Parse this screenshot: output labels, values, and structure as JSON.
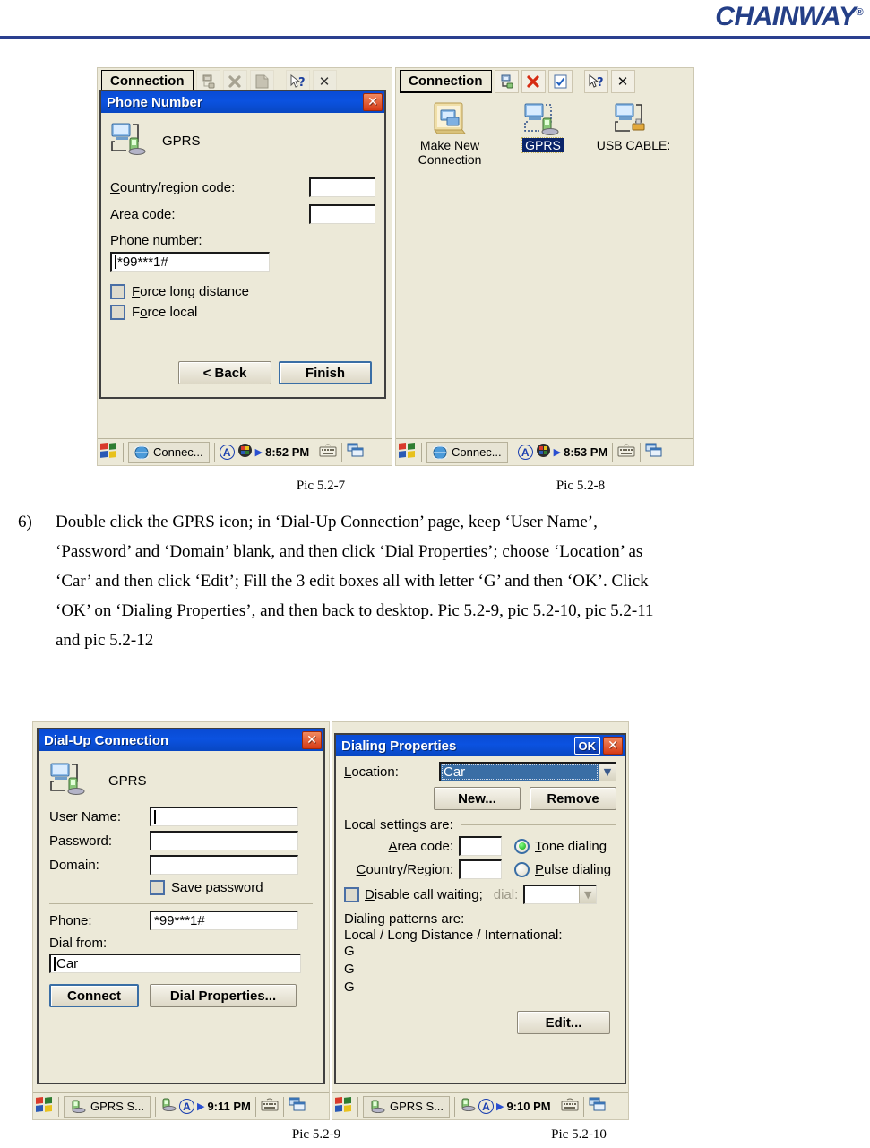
{
  "header": {
    "brand": "CHAINWAY",
    "registered": "®",
    "brand_color": "#243f87"
  },
  "pic_5_2_7": {
    "caption": "Pic 5.2-7",
    "cmdbar": {
      "tab": "Connection",
      "buttons": [
        "new-connection-icon",
        "delete-icon",
        "properties-icon",
        "help-icon",
        "close-icon"
      ]
    },
    "dialog": {
      "title": "Phone Number",
      "close_label": "✕",
      "connection_name": "GPRS",
      "fields": [
        {
          "label": "Country/region code:",
          "accel": "C",
          "value": ""
        },
        {
          "label": "Area code:",
          "accel": "A",
          "value": ""
        }
      ],
      "phone_label": "Phone number:",
      "phone_accel": "P",
      "phone_value": "*99***1#",
      "checkboxes": [
        {
          "label": "Force long distance",
          "accel": "F",
          "checked": false
        },
        {
          "label": "Force local",
          "accel": "o",
          "checked": false
        }
      ],
      "buttons": {
        "back": "< Back",
        "finish": "Finish"
      }
    },
    "taskbar": {
      "task": "Connec...",
      "ime": "A",
      "time": "8:52 PM"
    }
  },
  "pic_5_2_8": {
    "caption": "Pic 5.2-8",
    "cmdbar": {
      "tab": "Connection",
      "buttons": [
        "new-connection-icon",
        "delete-icon",
        "properties-icon",
        "help-icon",
        "close-icon"
      ]
    },
    "icons": [
      {
        "label": "Make New Connection",
        "selected": false
      },
      {
        "label": "GPRS",
        "selected": true
      },
      {
        "label": "USB CABLE:",
        "selected": false
      }
    ],
    "taskbar": {
      "task": "Connec...",
      "ime": "A",
      "time": "8:53 PM"
    }
  },
  "instruction": {
    "number": "6)",
    "lines": [
      "Double click the GPRS icon; in ‘Dial-Up Connection’ page, keep ‘User Name’,",
      "‘Password’ and ‘Domain’ blank, and then click ‘Dial Properties’; choose ‘Location’ as",
      "‘Car’ and then click ‘Edit’; Fill the 3 edit boxes all with letter ‘G’ and then ‘OK’. Click",
      "‘OK’ on ‘Dialing Properties’, and then back to desktop. Pic 5.2-9, pic 5.2-10, pic 5.2-11",
      "and pic 5.2-12"
    ]
  },
  "pic_5_2_9": {
    "caption": "Pic 5.2-9",
    "dialog": {
      "title": "Dial-Up Connection",
      "close_label": "✕",
      "connection_name": "GPRS",
      "fields": [
        {
          "label": "User Name:",
          "value": "",
          "focused": true
        },
        {
          "label": "Password:",
          "value": "",
          "focused": false
        },
        {
          "label": "Domain:",
          "value": "",
          "focused": false
        }
      ],
      "save_password": {
        "label": "Save password",
        "checked": false
      },
      "phone_label": "Phone:",
      "phone_value": "*99***1#",
      "dial_from_label": "Dial from:",
      "dial_from_value": "Car",
      "buttons": {
        "connect": "Connect",
        "dial_properties": "Dial Properties..."
      }
    },
    "taskbar": {
      "task": "GPRS S...",
      "ime": "A",
      "time": "9:11 PM"
    }
  },
  "pic_5_2_10": {
    "caption": "Pic 5.2-10",
    "dialog": {
      "title": "Dialing Properties",
      "ok_label": "OK",
      "close_label": "✕",
      "location_label": "Location:",
      "location_accel": "L",
      "location_value": "Car",
      "buttons": {
        "new": "New...",
        "remove": "Remove",
        "edit": "Edit..."
      },
      "local_settings_label": "Local settings are:",
      "area_code_label": "Area code:",
      "area_code_value": "",
      "country_region_label": "Country/Region:",
      "country_region_value": "",
      "dial_mode": [
        {
          "label": "Tone dialing",
          "accel": "T",
          "selected": true
        },
        {
          "label": "Pulse dialing",
          "accel": "P",
          "selected": false
        }
      ],
      "disable_call_waiting": {
        "label": "Disable call waiting;",
        "checked": false
      },
      "dial_label": "dial:",
      "dial_value": "",
      "patterns_label": "Dialing patterns are:",
      "patterns_header": "Local / Long Distance / International:",
      "patterns": [
        "G",
        "G",
        "G"
      ]
    },
    "taskbar": {
      "task": "GPRS S...",
      "ime": "A",
      "time": "9:10 PM"
    }
  }
}
